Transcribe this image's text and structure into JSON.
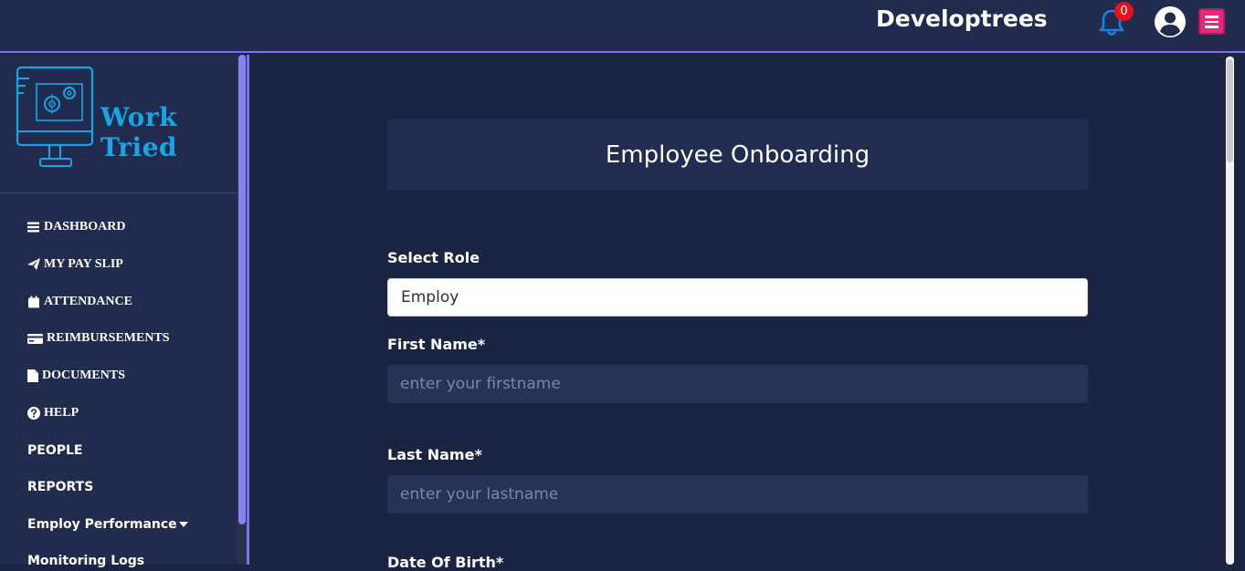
{
  "header": {
    "brand": "Developtrees",
    "notification_count": "0"
  },
  "sidebar": {
    "logo_text": "Work Tried",
    "items": [
      {
        "label": "DASHBOARD",
        "icon": "bars-icon"
      },
      {
        "label": "MY PAY SLIP",
        "icon": "paper-plane-icon"
      },
      {
        "label": "ATTENDANCE",
        "icon": "calendar-icon"
      },
      {
        "label": "REIMBURSEMENTS",
        "icon": "credit-card-icon"
      },
      {
        "label": "DOCUMENTS",
        "icon": "file-icon"
      },
      {
        "label": "HELP",
        "icon": "question-circle-icon"
      },
      {
        "label": "PEOPLE"
      },
      {
        "label": "REPORTS"
      },
      {
        "label": "Employ Performance",
        "icon": "caret-down-icon"
      },
      {
        "label": "Monitoring Logs"
      }
    ]
  },
  "form": {
    "title": "Employee Onboarding",
    "select_role_label": "Select Role",
    "select_role_value": "Employ",
    "first_name_label": "First Name*",
    "first_name_placeholder": "enter your firstname",
    "last_name_label": "Last Name*",
    "last_name_placeholder": "enter your lastname",
    "dob_label": "Date Of Birth*"
  },
  "colors": {
    "accent": "#7c6ff0",
    "menu_button": "#e8287a",
    "bell": "#1a7fe8",
    "badge": "#e8121f",
    "logo": "#1aa4e8"
  }
}
